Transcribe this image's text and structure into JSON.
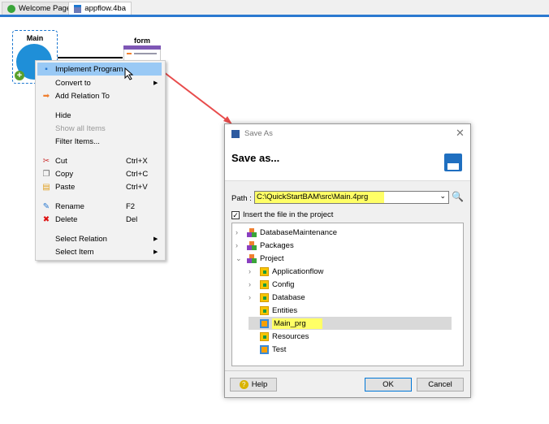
{
  "tabs": [
    {
      "label": "Welcome Page",
      "icon": "home-icon"
    },
    {
      "label": "appflow.4ba",
      "icon": "appflow-icon",
      "active": true
    }
  ],
  "canvas": {
    "main_node": "Main",
    "form_node": "form"
  },
  "context_menu": {
    "items": [
      {
        "label": "Implement Program",
        "icon": "program-icon",
        "highlighted": true
      },
      {
        "label": "Convert to",
        "submenu": true
      },
      {
        "label": "Add Relation To",
        "icon": "arrow-right-icon"
      },
      {
        "label": "Hide"
      },
      {
        "label": "Show all Items",
        "disabled": true
      },
      {
        "label": "Filter Items..."
      },
      {
        "label": "Cut",
        "icon": "scissors-icon",
        "shortcut": "Ctrl+X"
      },
      {
        "label": "Copy",
        "icon": "copy-icon",
        "shortcut": "Ctrl+C"
      },
      {
        "label": "Paste",
        "icon": "paste-icon",
        "shortcut": "Ctrl+V"
      },
      {
        "label": "Rename",
        "icon": "rename-icon",
        "shortcut": "F2"
      },
      {
        "label": "Delete",
        "icon": "delete-icon",
        "shortcut": "Del"
      },
      {
        "label": "Select Relation",
        "submenu": true
      },
      {
        "label": "Select Item",
        "submenu": true
      }
    ]
  },
  "dialog": {
    "title": "Save As",
    "heading": "Save as...",
    "path_label": "Path :",
    "path_value": "C:\\QuickStartBAM\\src\\Main.4prg",
    "checkbox_label": "Insert the file in the project",
    "checkbox_checked": true,
    "tree": [
      {
        "label": "DatabaseMaintenance",
        "level": 0,
        "expander": ">",
        "type": "package"
      },
      {
        "label": "Packages",
        "level": 0,
        "expander": ">",
        "type": "package"
      },
      {
        "label": "Project",
        "level": 0,
        "expander": "v",
        "type": "package"
      },
      {
        "label": "Applicationflow",
        "level": 1,
        "expander": ">",
        "type": "folder"
      },
      {
        "label": "Config",
        "level": 1,
        "expander": ">",
        "type": "folder"
      },
      {
        "label": "Database",
        "level": 1,
        "expander": ">",
        "type": "folder"
      },
      {
        "label": "Entities",
        "level": 1,
        "expander": "",
        "type": "folder"
      },
      {
        "label": "Main_prg",
        "level": 1,
        "expander": "",
        "type": "program",
        "selected": true
      },
      {
        "label": "Resources",
        "level": 1,
        "expander": "",
        "type": "folder"
      },
      {
        "label": "Test",
        "level": 1,
        "expander": "",
        "type": "program"
      }
    ],
    "help_label": "Help",
    "ok_label": "OK",
    "cancel_label": "Cancel"
  },
  "colors": {
    "accent": "#2b79d0",
    "highlight": "#ffff66",
    "menu_highlight": "#99c9f5",
    "arrow": "#e84c4c"
  }
}
